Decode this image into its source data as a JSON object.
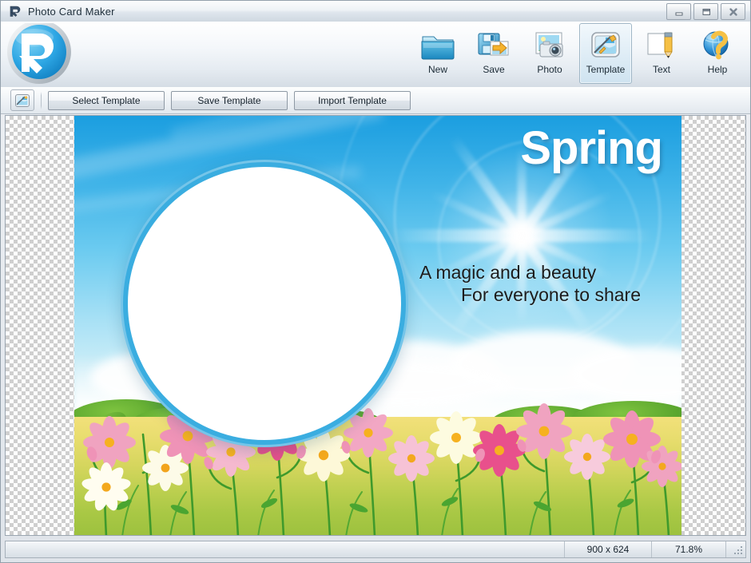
{
  "window": {
    "title": "Photo Card Maker",
    "app_icon": "p-logo-icon",
    "controls": {
      "minimize": "minimize-icon",
      "restore": "restore-icon",
      "close": "close-icon"
    }
  },
  "toolbar": {
    "items": [
      {
        "id": "new",
        "label": "New",
        "icon": "folder-icon",
        "selected": false
      },
      {
        "id": "save",
        "label": "Save",
        "icon": "floppy-save-icon",
        "selected": false
      },
      {
        "id": "photo",
        "label": "Photo",
        "icon": "camera-photo-icon",
        "selected": false
      },
      {
        "id": "template",
        "label": "Template",
        "icon": "template-icon",
        "selected": true
      },
      {
        "id": "text",
        "label": "Text",
        "icon": "pencil-text-icon",
        "selected": false
      },
      {
        "id": "help",
        "label": "Help",
        "icon": "help-globe-icon",
        "selected": false
      }
    ]
  },
  "subtoolbar": {
    "icon": "template-small-icon",
    "buttons": [
      {
        "id": "select-template",
        "label": "Select Template"
      },
      {
        "id": "save-template",
        "label": "Save Template"
      },
      {
        "id": "import-template",
        "label": "Import Template"
      }
    ]
  },
  "canvas": {
    "card": {
      "title": "Spring",
      "line1": "A magic and a beauty",
      "line2": "For everyone to share",
      "photo_placeholder": "empty-circle-photo-slot"
    }
  },
  "statusbar": {
    "dimensions": "900 x 624",
    "zoom": "71.8%",
    "grip": "resize-grip-icon"
  },
  "colors": {
    "sky_top": "#1b9ee0",
    "frame_blue": "#3aade0",
    "meadow_top": "#f2e07a",
    "meadow_bottom": "#9cc13e",
    "title_white": "#ffffff",
    "text_dark": "#1b1b1b"
  }
}
